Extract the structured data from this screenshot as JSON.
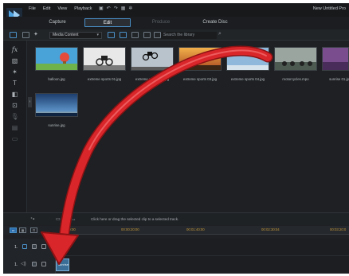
{
  "menu": {
    "items": [
      "File",
      "Edit",
      "View",
      "Playback"
    ],
    "window_title": "New Untitled Pro"
  },
  "modes": {
    "capture": "Capture",
    "edit": "Edit",
    "produce": "Produce",
    "create_disc": "Create Disc"
  },
  "library": {
    "dropdown_value": "Media Content",
    "search_placeholder": "Search the library",
    "items": [
      {
        "name": "balloon.jpg",
        "scene": "balloon"
      },
      {
        "name": "extreme sports 01.jpg",
        "scene": "bike1"
      },
      {
        "name": "extreme sports 02.jpg",
        "scene": "bike2"
      },
      {
        "name": "extreme sports 03.jpg",
        "scene": "sunset"
      },
      {
        "name": "extreme sports 04.jpg",
        "scene": "sky"
      },
      {
        "name": "motorcycles.mpo",
        "scene": "moto"
      },
      {
        "name": "sunrise 01.jp",
        "scene": "dusk"
      },
      {
        "name": "sunrise.jpg",
        "scene": "sunrise"
      }
    ]
  },
  "timeline": {
    "hint": "Click here or drag the selected clip to a selected track.",
    "ticks": [
      "00:00",
      "00:00:20:00",
      "00:01:40:00",
      "00:02:30:04",
      "00:03:20:0"
    ],
    "tracks": [
      {
        "label": "1."
      },
      {
        "label": "1."
      }
    ],
    "clip_label": "sunrise"
  },
  "colors": {
    "accent": "#4a90c8",
    "arrow": "#d9262a",
    "tick_text": "#c79a3e"
  }
}
